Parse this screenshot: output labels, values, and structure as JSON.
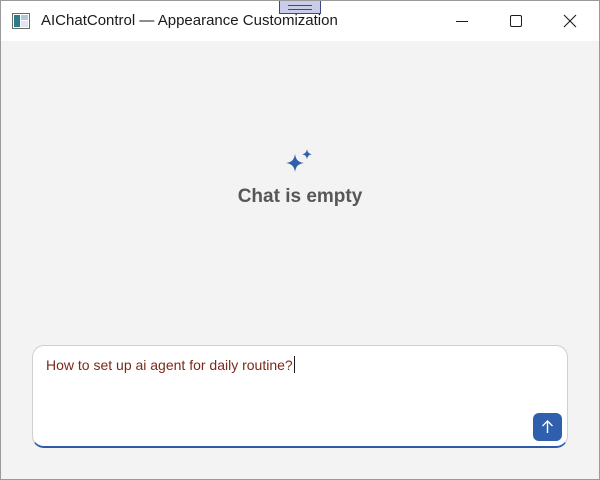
{
  "window": {
    "title": "AIChatControl — Appearance Customization",
    "app_icon": "app-window-icon",
    "controls": {
      "minimize": "minimize-icon",
      "maximize": "maximize-icon",
      "close": "close-icon"
    }
  },
  "empty_state": {
    "icon": "sparkle-icon",
    "text": "Chat is empty",
    "icon_color": "#2f5fad"
  },
  "chat_input": {
    "value": "How to set up ai agent for daily routine?",
    "send_icon": "arrow-up-icon",
    "send_color": "#2f5fad",
    "focus_underline_color": "#2e5aac"
  }
}
